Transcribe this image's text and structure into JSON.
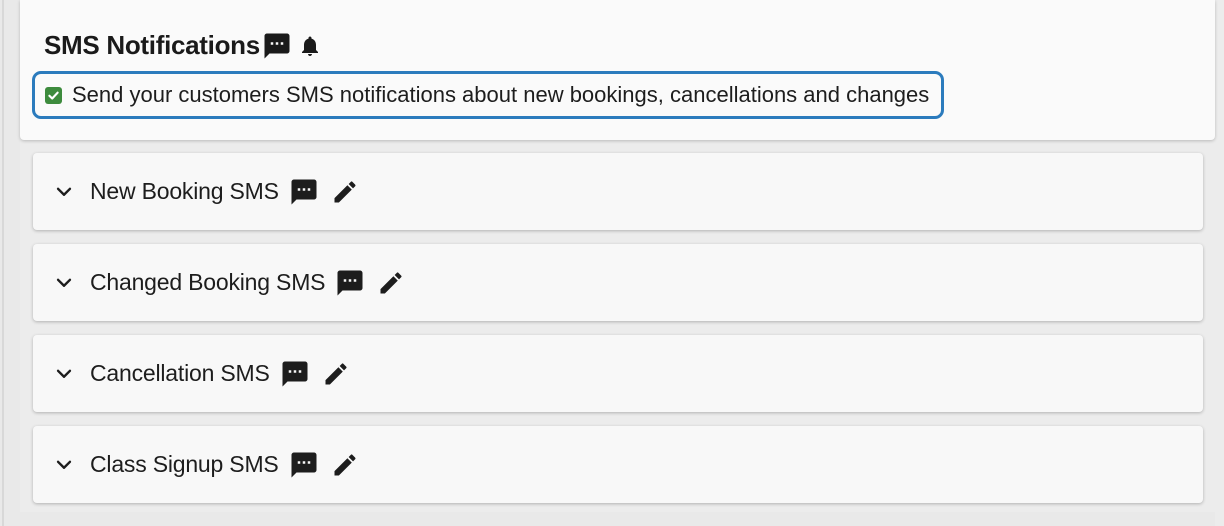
{
  "header": {
    "title": "SMS Notifications",
    "icons": [
      "sms-icon",
      "bell-icon"
    ]
  },
  "sms_toggle": {
    "checked": true,
    "label": "Send your customers SMS notifications about new bookings, cancellations and changes",
    "checkbox_color": "#3d8b3d",
    "focus_ring_color": "#2b7bbd"
  },
  "sections": [
    {
      "label": "New Booking SMS",
      "icons": [
        "chevron-down-icon",
        "sms-icon",
        "edit-icon"
      ]
    },
    {
      "label": "Changed Booking SMS",
      "icons": [
        "chevron-down-icon",
        "sms-icon",
        "edit-icon"
      ]
    },
    {
      "label": "Cancellation SMS",
      "icons": [
        "chevron-down-icon",
        "sms-icon",
        "edit-icon"
      ]
    },
    {
      "label": "Class Signup SMS",
      "icons": [
        "chevron-down-icon",
        "sms-icon",
        "edit-icon"
      ]
    }
  ]
}
